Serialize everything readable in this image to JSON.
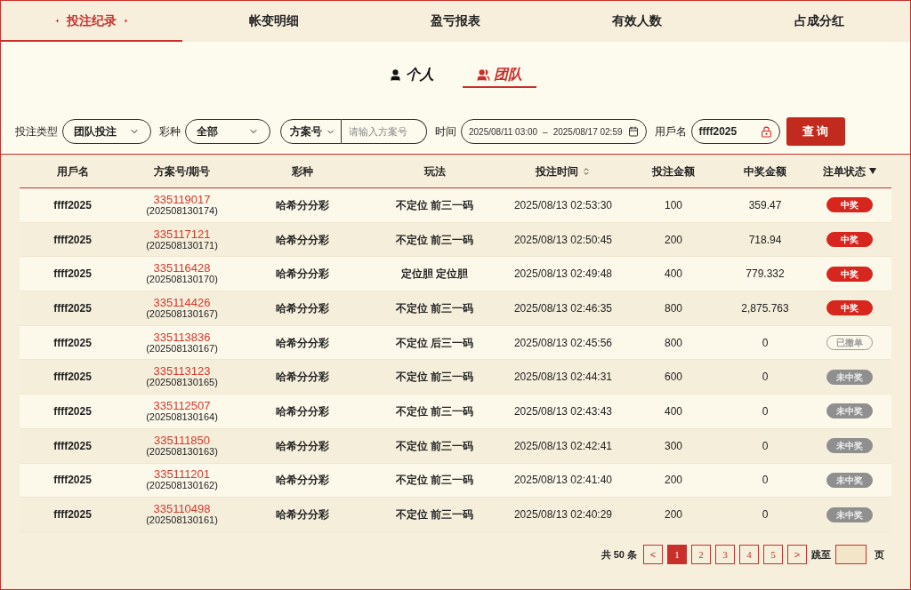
{
  "tabs": [
    {
      "label": "投注纪录",
      "selected": true
    },
    {
      "label": "帐变明细",
      "selected": false
    },
    {
      "label": "盈亏报表",
      "selected": false
    },
    {
      "label": "有效人数",
      "selected": false
    },
    {
      "label": "占成分红",
      "selected": false
    }
  ],
  "scope_tabs": [
    {
      "label": "个人",
      "kind": "person",
      "selected": false
    },
    {
      "label": "团队",
      "kind": "team",
      "selected": true
    }
  ],
  "filters": {
    "bet_type": {
      "label": "投注类型",
      "value": "团队投注"
    },
    "lottery": {
      "label": "彩种",
      "value": "全部"
    },
    "plan": {
      "select": "方案号",
      "placeholder": "请输入方案号"
    },
    "time": {
      "label": "时间",
      "start": "2025/08/11 03:00",
      "separator": "–",
      "end": "2025/08/17 02:59"
    },
    "username": {
      "label": "用戶名",
      "value": "ffff2025"
    },
    "query_button": "查 询"
  },
  "table": {
    "columns": [
      "用戶名",
      "方案号/期号",
      "彩种",
      "玩法",
      "投注时间",
      "投注金额",
      "中奖金额",
      "注单状态"
    ],
    "rows": [
      {
        "user": "ffff2025",
        "plan": "335119017",
        "issue": "(202508130174)",
        "lottery": "哈希分分彩",
        "play": "不定位 前三一码",
        "time": "2025/08/13 02:53:30",
        "amount": "100",
        "prize": "359.47",
        "status": "中奖",
        "kind": "won"
      },
      {
        "user": "ffff2025",
        "plan": "335117121",
        "issue": "(202508130171)",
        "lottery": "哈希分分彩",
        "play": "不定位 前三一码",
        "time": "2025/08/13 02:50:45",
        "amount": "200",
        "prize": "718.94",
        "status": "中奖",
        "kind": "won"
      },
      {
        "user": "ffff2025",
        "plan": "335116428",
        "issue": "(202508130170)",
        "lottery": "哈希分分彩",
        "play": "定位胆 定位胆",
        "time": "2025/08/13 02:49:48",
        "amount": "400",
        "prize": "779.332",
        "status": "中奖",
        "kind": "won"
      },
      {
        "user": "ffff2025",
        "plan": "335114426",
        "issue": "(202508130167)",
        "lottery": "哈希分分彩",
        "play": "不定位 前三一码",
        "time": "2025/08/13 02:46:35",
        "amount": "800",
        "prize": "2,875.763",
        "status": "中奖",
        "kind": "won"
      },
      {
        "user": "ffff2025",
        "plan": "335113836",
        "issue": "(202508130167)",
        "lottery": "哈希分分彩",
        "play": "不定位 后三一码",
        "time": "2025/08/13 02:45:56",
        "amount": "800",
        "prize": "0",
        "status": "已撤单",
        "kind": "cancelled"
      },
      {
        "user": "ffff2025",
        "plan": "335113123",
        "issue": "(202508130165)",
        "lottery": "哈希分分彩",
        "play": "不定位 前三一码",
        "time": "2025/08/13 02:44:31",
        "amount": "600",
        "prize": "0",
        "status": "未中奖",
        "kind": "lost"
      },
      {
        "user": "ffff2025",
        "plan": "335112507",
        "issue": "(202508130164)",
        "lottery": "哈希分分彩",
        "play": "不定位 前三一码",
        "time": "2025/08/13 02:43:43",
        "amount": "400",
        "prize": "0",
        "status": "未中奖",
        "kind": "lost"
      },
      {
        "user": "ffff2025",
        "plan": "335111850",
        "issue": "(202508130163)",
        "lottery": "哈希分分彩",
        "play": "不定位 前三一码",
        "time": "2025/08/13 02:42:41",
        "amount": "300",
        "prize": "0",
        "status": "未中奖",
        "kind": "lost"
      },
      {
        "user": "ffff2025",
        "plan": "335111201",
        "issue": "(202508130162)",
        "lottery": "哈希分分彩",
        "play": "不定位 前三一码",
        "time": "2025/08/13 02:41:40",
        "amount": "200",
        "prize": "0",
        "status": "未中奖",
        "kind": "lost"
      },
      {
        "user": "ffff2025",
        "plan": "335110498",
        "issue": "(202508130161)",
        "lottery": "哈希分分彩",
        "play": "不定位 前三一码",
        "time": "2025/08/13 02:40:29",
        "amount": "200",
        "prize": "0",
        "status": "未中奖",
        "kind": "lost"
      }
    ]
  },
  "pagination": {
    "total": "共 50 条",
    "prev": "<",
    "pages": [
      {
        "label": "1",
        "selected": true
      },
      {
        "label": "2",
        "selected": false
      },
      {
        "label": "3",
        "selected": false
      },
      {
        "label": "4",
        "selected": false
      },
      {
        "label": "5",
        "selected": false
      }
    ],
    "next": ">",
    "jump_label": "跳至",
    "page_suffix": "页"
  }
}
